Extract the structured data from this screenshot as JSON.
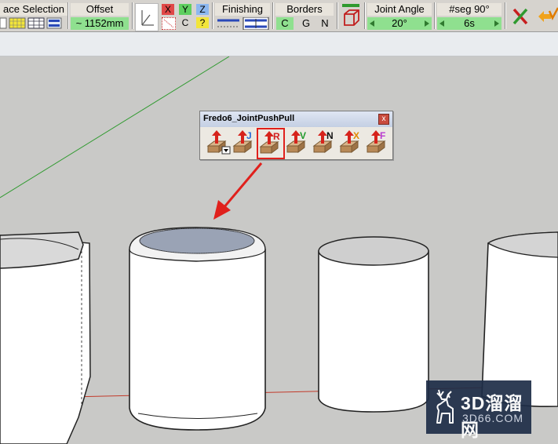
{
  "toolbar": {
    "face_selection": {
      "label": "ace Selection"
    },
    "offset": {
      "label": "Offset",
      "value": "~ 1152mm"
    },
    "axes": {
      "x": "X",
      "y": "Y",
      "z": "Z",
      "c": "C",
      "q": "?"
    },
    "finishing": {
      "label": "Finishing"
    },
    "borders": {
      "label": "Borders",
      "c": "C",
      "g": "G",
      "n": "N"
    },
    "joint_angle": {
      "label": "Joint Angle",
      "value": "20°"
    },
    "seg": {
      "label": "#seg 90°",
      "value": "6s"
    }
  },
  "palette": {
    "title": "Fredo6_JointPushPull",
    "close": "x",
    "buttons": [
      {
        "name": "default",
        "letter": "",
        "color": "#000000"
      },
      {
        "name": "j",
        "letter": "J",
        "color": "#2a6cd6"
      },
      {
        "name": "r",
        "letter": "R",
        "color": "#d21f1f",
        "highlighted": true
      },
      {
        "name": "v",
        "letter": "V",
        "color": "#1f9a2b"
      },
      {
        "name": "n",
        "letter": "N",
        "color": "#111111"
      },
      {
        "name": "x",
        "letter": "X",
        "color": "#e08a00"
      },
      {
        "name": "f",
        "letter": "F",
        "color": "#b83bd1"
      }
    ]
  },
  "watermark": {
    "brand": "3D溜溜网",
    "domain": "3D66.COM"
  },
  "colors": {
    "highlight": "#e0201c",
    "arrow": "#e0201c",
    "green_axis": "#2f9a2f",
    "red_axis": "#c23a2a"
  }
}
